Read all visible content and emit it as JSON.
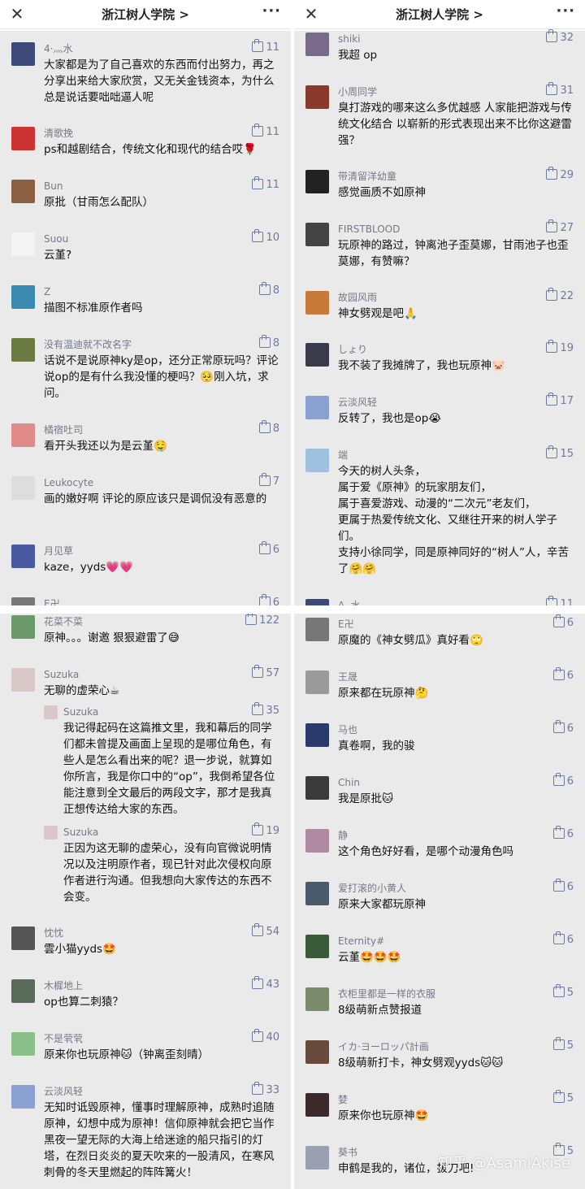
{
  "title": "浙江树人学院 >",
  "panels": {
    "tl": [
      {
        "name": "4·灬水",
        "likes": "11",
        "text": "大家都是为了自己喜欢的东西而付出努力，再之分享出来给大家欣赏，又无关金钱资本，为什么总是说话要咄咄逼人呢",
        "color": "#3c4a7a"
      },
      {
        "name": "清歌挽",
        "likes": "11",
        "text": "ps和越剧结合，传统文化和现代的结合哎🌹",
        "color": "#c33"
      },
      {
        "name": "Bun",
        "likes": "11",
        "text": "原批（甘雨怎么配队）",
        "color": "#8a6040"
      },
      {
        "name": "Suou",
        "likes": "10",
        "text": "云堇?",
        "color": "#f4f4f4"
      },
      {
        "name": "Z",
        "likes": "8",
        "text": "描图不标准原作者吗",
        "color": "#3a8ab0"
      },
      {
        "name": "没有温迪就不改名字",
        "likes": "8",
        "text": "话说不是说原神ky是op，还分正常原玩吗？评论说op的是有什么我没懂的梗吗？🥺刚入坑，求问。",
        "color": "#6a7a40"
      },
      {
        "name": "橘宿吐司",
        "likes": "8",
        "text": "看开头我还以为是云堇🤤",
        "color": "#e08a8a"
      },
      {
        "name": "Leukocyte",
        "likes": "7",
        "text": "画的嫩好啊 评论的原应该只是调侃没有恶意的",
        "color": "#ddd"
      },
      {
        "name": "月见草",
        "likes": "6",
        "text": "kaze，yyds💗💗",
        "color": "#4a5aa0"
      },
      {
        "name": "E卍",
        "likes": "6",
        "text": "",
        "color": "#777"
      }
    ],
    "tr": [
      {
        "name": "shiki",
        "likes": "32",
        "text": "我超 op",
        "color": "#7a6a8a"
      },
      {
        "name": "小周同学",
        "likes": "31",
        "text": "臭打游戏的哪来这么多优越感 人家能把游戏与传统文化结合 以崭新的形式表现出来不比你这避雷强？",
        "color": "#8a3a2a"
      },
      {
        "name": "带清留洋幼童",
        "likes": "29",
        "text": "感觉画质不如原神",
        "color": "#222"
      },
      {
        "name": "FIRSTBLOOD",
        "likes": "27",
        "text": "玩原神的路过，钟离池子歪莫娜，甘雨池子也歪莫娜，有赞嘛？",
        "color": "#444"
      },
      {
        "name": "故园风雨",
        "likes": "22",
        "text": "神女劈观是吧🙏",
        "color": "#c87a3a"
      },
      {
        "name": "しょり",
        "likes": "19",
        "text": "我不装了我摊牌了，我也玩原神🐷",
        "color": "#3a3a4a"
      },
      {
        "name": "云淡风轻",
        "likes": "17",
        "text": "反转了，我也是op😭",
        "color": "#8aa0d0"
      },
      {
        "name": "端",
        "likes": "15",
        "text": "今天的树人头条，\n属于爱《原神》的玩家朋友们，\n属于喜爱游戏、动漫的“二次元”老友们，\n更属于热爱传统文化、又继往开来的树人学子们。\n支持小徐同学，同是原神同好的“树人”人，辛苦了🤗🤗",
        "color": "#a0c0e0"
      },
      {
        "name": "A. 水",
        "likes": "11",
        "text": "",
        "color": "#3c4a7a"
      }
    ],
    "bl": [
      {
        "name": "花菜不菜",
        "likes": "122",
        "text": "原神。。。谢邀 狠狠避雷了😅",
        "color": "#6a9a6a"
      },
      {
        "name": "Suzuka",
        "likes": "57",
        "text": "无聊的虚荣心☕",
        "color": "#d8c8c8"
      },
      {
        "name": "Suzuka",
        "likes": "35",
        "text": "我记得起码在这篇推文里，我和幕后的同学们都未曾提及画面上呈现的是哪位角色，有些人是怎么看出来的呢？退一步说，就算如你所言，我是你口中的“op”，我倒希望各位能注意到全文最后的两段文字，那才是我真正想传达给大家的东西。",
        "color": "#d8c8c8",
        "reply": true
      },
      {
        "name": "Suzuka",
        "likes": "19",
        "text": "正因为这无聊的虚荣心，没有向官微说明情况以及注明原作者，现已针对此次侵权向原作者进行沟通。但我想向大家传达的东西不会变。",
        "color": "#d8c8c8",
        "reply": true
      },
      {
        "name": "忱忱",
        "likes": "54",
        "text": "雲小猫yyds🤩",
        "color": "#555"
      },
      {
        "name": "木樨地上",
        "likes": "43",
        "text": "op也算二刺猿？",
        "color": "#5a6a5a"
      },
      {
        "name": "不是茕茕",
        "likes": "40",
        "text": "原来你也玩原神🐱（钟离歪刻晴）",
        "color": "#8ac08a"
      },
      {
        "name": "云淡风轻",
        "likes": "33",
        "text": "无知时诋毁原神，懂事时理解原神，成熟时追随原神，幻想中成为原神！信仰原神就会把它当作黑夜一望无际的大海上给迷途的船只指引的灯塔，在烈日炎炎的夏天吹来的一股清风，在寒风刺骨的冬天里燃起的阵阵篝火！",
        "color": "#8aa0d0"
      }
    ],
    "br": [
      {
        "name": "E卍",
        "likes": "6",
        "text": "原魔的《神女劈瓜》真好看🙄",
        "color": "#777"
      },
      {
        "name": "王晟",
        "likes": "6",
        "text": "原来都在玩原神🤔",
        "color": "#9a9a9a"
      },
      {
        "name": "马也",
        "likes": "6",
        "text": "真卷啊，我的骏",
        "color": "#2a3a6a"
      },
      {
        "name": "Chin",
        "likes": "6",
        "text": "我是原批🐱",
        "color": "#3a3a3a"
      },
      {
        "name": "静",
        "likes": "6",
        "text": "这个角色好好看，是哪个动漫角色吗",
        "color": "#b08aa0"
      },
      {
        "name": "爱打滚的小黄人",
        "likes": "6",
        "text": "原来大家都玩原神",
        "color": "#4a5a6a"
      },
      {
        "name": "Eternity#",
        "likes": "6",
        "text": "云堇🤩🤩🤩",
        "color": "#3a5a3a"
      },
      {
        "name": "衣柜里都是一样的衣服",
        "likes": "5",
        "text": "8级萌新点赞报道",
        "color": "#7a8a6a"
      },
      {
        "name": "イカ·ヨーロッパ計画",
        "likes": "5",
        "text": "8级萌新打卡，神女劈观yyds🐱🐱",
        "color": "#6a4a3a"
      },
      {
        "name": "婪",
        "likes": "5",
        "text": "原来你也玩原神🤩",
        "color": "#3a2a2a"
      },
      {
        "name": "葵书",
        "likes": "5",
        "text": "申鹤是我的，诸位，拔刀吧!",
        "color": "#9aa0b0"
      }
    ]
  },
  "watermark": "知乎 @AsamiAkise"
}
